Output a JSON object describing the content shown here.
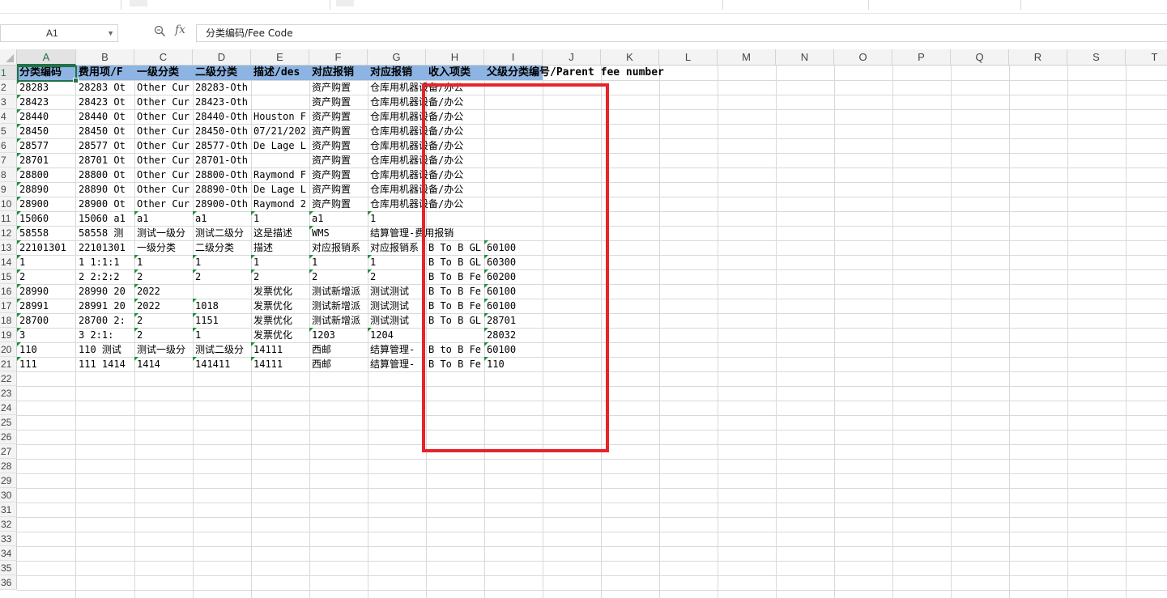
{
  "formula_bar": {
    "name_box": "A1",
    "zoom_icon": "zoom-icon",
    "fx_label": "fx",
    "formula": "分类编码/Fee Code"
  },
  "columns": [
    "A",
    "B",
    "C",
    "D",
    "E",
    "F",
    "G",
    "H",
    "I",
    "J",
    "K",
    "L",
    "M",
    "N",
    "O",
    "P",
    "Q",
    "R",
    "S",
    "T"
  ],
  "rows": [
    "1",
    "2",
    "3",
    "4",
    "5",
    "6",
    "7",
    "8",
    "9",
    "10",
    "11",
    "12",
    "13",
    "14",
    "15",
    "16",
    "17",
    "18",
    "19",
    "20",
    "21",
    "22",
    "23",
    "24",
    "25",
    "26",
    "27",
    "28",
    "29",
    "30",
    "31",
    "32",
    "33",
    "34",
    "35",
    "36"
  ],
  "selected_cell": "A1",
  "header_row": [
    "分类编码",
    "费用项/F",
    "一级分类",
    "二级分类",
    "描述/des",
    "对应报销",
    "对应报销",
    "收入项类",
    "父级分类编号/Parent fee number"
  ],
  "data_rows": [
    [
      "28283",
      "28283   Ot",
      "Other Cur",
      "28283-Oth",
      "",
      "资产购置 ",
      "仓库用机器设备/办公"
    ],
    [
      "28423",
      "28423   Ot",
      "Other Cur",
      "28423-Oth",
      "",
      "资产购置 ",
      "仓库用机器设备/办公"
    ],
    [
      "28440",
      "28440   Ot",
      "Other Cur",
      "28440-Oth",
      "Houston F",
      "资产购置 ",
      "仓库用机器设备/办公"
    ],
    [
      "28450",
      "28450   Ot",
      "Other Cur",
      "28450-Oth",
      "07/21/202",
      "资产购置 ",
      "仓库用机器设备/办公"
    ],
    [
      "28577",
      "28577   Ot",
      "Other Cur",
      "28577-Oth",
      "De Lage L",
      "资产购置 ",
      "仓库用机器设备/办公"
    ],
    [
      "28701",
      "28701   Ot",
      "Other Cur",
      "28701-Oth",
      "",
      "资产购置 ",
      "仓库用机器设备/办公"
    ],
    [
      "28800",
      "28800   Ot",
      "Other Cur",
      "28800-Oth",
      "Raymond F",
      "资产购置 ",
      "仓库用机器设备/办公"
    ],
    [
      "28890",
      "28890   Ot",
      "Other Cur",
      "28890-Oth",
      "De Lage L",
      "资产购置 ",
      "仓库用机器设备/办公"
    ],
    [
      "28900",
      "28900   Ot",
      "Other Cur",
      "28900-Oth",
      "Raymond 2",
      "资产购置 ",
      "仓库用机器设备/办公"
    ],
    [
      "15060",
      "15060   a1",
      "a1",
      "a1",
      "1",
      "a1",
      "1",
      "",
      ""
    ],
    [
      "58558",
      "58558   测",
      "测试一级分",
      "测试二级分",
      "这是描述 ",
      "WMS",
      "结算管理-费用报销",
      "",
      ""
    ],
    [
      "22101301",
      "22101301",
      "一级分类",
      "二级分类",
      "描述",
      "对应报销系",
      "对应报销系",
      "B To B GL",
      "60100"
    ],
    [
      "1",
      "1   1:1:1",
      "1",
      "1",
      "1",
      "1",
      "1",
      "B To B GL",
      "60300"
    ],
    [
      "2",
      "2   2:2:2",
      "2",
      "2",
      "2",
      "2",
      "2",
      "B To B Fe",
      "60200"
    ],
    [
      "28990",
      "28990   20",
      "2022",
      "",
      "发票优化",
      "测试新增派",
      "测试测试",
      "B To B Fe",
      "60100"
    ],
    [
      "28991",
      "28991   20",
      "2022",
      "1018",
      "发票优化",
      "测试新增派",
      "测试测试",
      "B To B Fe",
      "60100"
    ],
    [
      "28700",
      "28700   2:",
      "2",
      "1151",
      "发票优化",
      "测试新增派",
      "测试测试",
      "B To B GL",
      "28701"
    ],
    [
      "3",
      "3   2:1:",
      "2",
      "1",
      "发票优化",
      "1203",
      "1204",
      "",
      "28032"
    ],
    [
      "110",
      "110   测试",
      "测试一级分",
      "测试二级分",
      "14111",
      "西邮",
      "结算管理-",
      "B to B Fe",
      "60100"
    ],
    [
      "111",
      "111   1414",
      "1414",
      "141411",
      "14111",
      "西邮",
      "结算管理-",
      "B To B Fe",
      "110"
    ]
  ],
  "colors": {
    "header_fill": "#8db4e2",
    "selection": "#217346",
    "annotation_box": "#e8232a",
    "comment_marker": "#1e8f3a"
  }
}
